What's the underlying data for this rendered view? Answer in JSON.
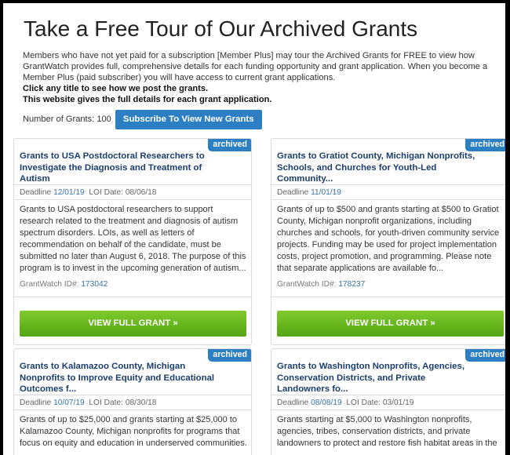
{
  "header": {
    "title": "Take a Free Tour of Our Archived Grants",
    "intro_lines": [
      "Members who have not yet paid for a subscription [Member Plus] may tour the Archived Grants for FREE to view how",
      "GrantWatch provides full, comprehensive details for each funding opportunity and grant application. When you become a",
      "Member Plus (paid subscriber) you will have access to current grant applications."
    ],
    "bold_line_1": "Click any title to see how we post the grants.",
    "bold_line_2": "This website gives the full details for each grant application.",
    "count_label": "Number of Grants: 100",
    "subscribe_button": "Subscribe To View New Grants"
  },
  "cards": [
    {
      "badge": "archived",
      "title": "Grants to USA Postdoctoral Researchers to Investigate the Diagnosis and Treatment of Autism",
      "deadline_label": "Deadline",
      "deadline": "12/01/19",
      "loi_text": "LOI Date: 08/06/18",
      "desc_lines": [
        "Grants to USA postdoctoral researchers to support",
        "research related to the treatment and diagnosis of autism",
        "spectrum disorders. LOIs, as well as letters of",
        "recommendation on behalf of the candidate, must be",
        "submitted no later than August 6, 2018. The purpose of this",
        "program is to invest in the upcoming generation of autism..."
      ],
      "id_label": "GrantWatch ID#:",
      "id": "173042",
      "button": "VIEW FULL GRANT »"
    },
    {
      "badge": "archived",
      "title": "Grants to Gratiot County, Michigan Nonprofits, Schools, and Churches for Youth-Led Community...",
      "deadline_label": "Deadline",
      "deadline": "11/01/19",
      "loi_text": "",
      "desc_lines": [
        "Grants of up to $500 and grants starting at $500 to Gratiot",
        "County, Michigan nonprofit organizations, including",
        "churches and schools, for youth-driven community service",
        "projects. Funding may be used for project implementation",
        "costs, project promotion, and programming. Please note",
        "that separate applications are available fo..."
      ],
      "id_label": "GrantWatch ID#:",
      "id": "178237",
      "button": "VIEW FULL GRANT »"
    },
    {
      "badge": "archived",
      "title": "Grants to Kalamazoo County, Michigan Nonprofits to Improve Equity and Educational Outcomes f...",
      "deadline_label": "Deadline",
      "deadline": "10/07/19",
      "loi_text": "LOI Date: 08/30/18",
      "desc_lines": [
        "Grants of up to $25,000 and grants starting at $25,000 to",
        "Kalamazoo County, Michigan nonprofits for programs that",
        "focus on equity and education in underserved communities."
      ]
    },
    {
      "badge": "archived",
      "title": "Grants to Washington Nonprofits, Agencies, Conservation Districts, and Private Landowners fo...",
      "deadline_label": "Deadline",
      "deadline": "08/08/19",
      "loi_text": "LOI Date: 03/01/19",
      "desc_lines": [
        "Grants starting at $5,000 to Washington nonprofits,",
        "agencies, tribes, conservation districts, and private",
        "landowners to protect and restore fish habitat areas in the"
      ]
    }
  ]
}
